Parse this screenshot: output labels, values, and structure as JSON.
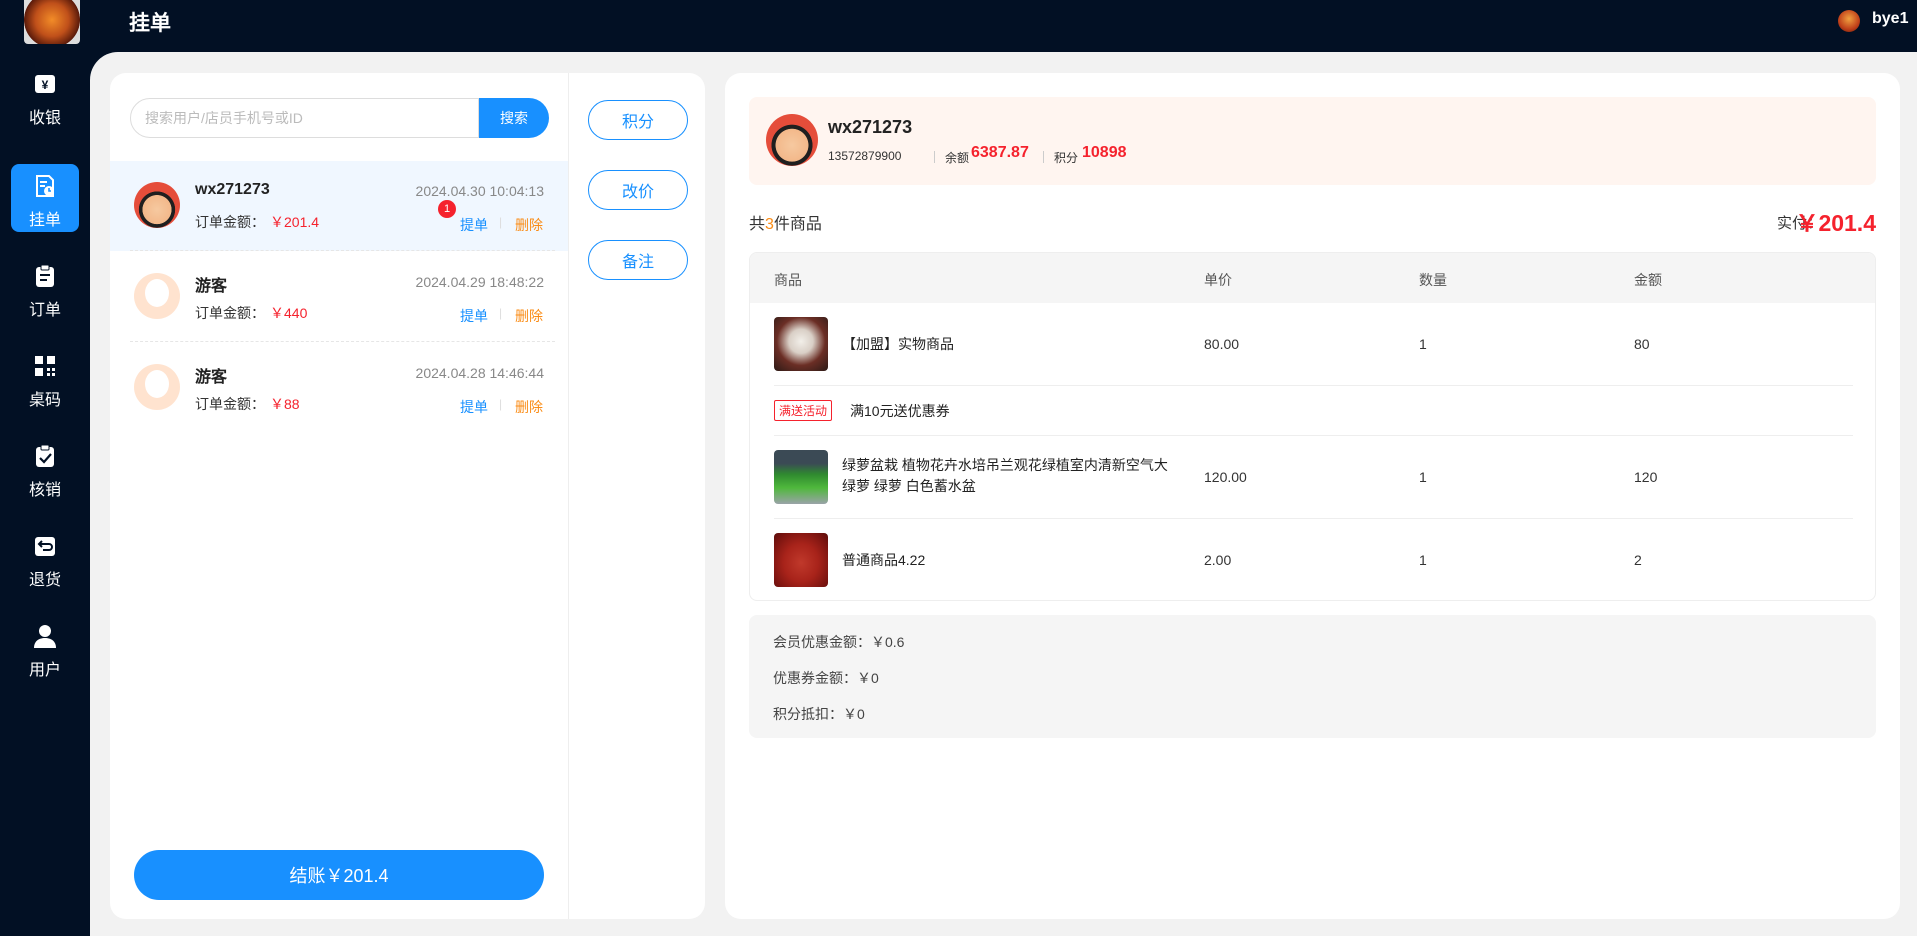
{
  "header": {
    "title": "挂单",
    "user_name": "bye1"
  },
  "sidebar": {
    "items": [
      {
        "label": "收银",
        "icon": "cash-register-icon",
        "active": false
      },
      {
        "label": "挂单",
        "icon": "hold-order-icon",
        "active": true
      },
      {
        "label": "订单",
        "icon": "clipboard-icon",
        "active": false
      },
      {
        "label": "桌码",
        "icon": "qr-code-icon",
        "active": false
      },
      {
        "label": "核销",
        "icon": "verify-icon",
        "active": false
      },
      {
        "label": "退货",
        "icon": "return-icon",
        "active": false
      },
      {
        "label": "用户",
        "icon": "user-icon",
        "active": false
      }
    ]
  },
  "search": {
    "placeholder": "搜索用户/店员手机号或ID",
    "button": "搜索"
  },
  "orders": [
    {
      "name": "wx271273",
      "time": "2024.04.30 10:04:13",
      "amount_label": "订单金额：",
      "amount": "￥201.4",
      "badge": "1",
      "pick": "提单",
      "delete": "删除"
    },
    {
      "name": "游客",
      "time": "2024.04.29 18:48:22",
      "amount_label": "订单金额：",
      "amount": "￥440",
      "pick": "提单",
      "delete": "删除"
    },
    {
      "name": "游客",
      "time": "2024.04.28 14:46:44",
      "amount_label": "订单金额：",
      "amount": "￥88",
      "pick": "提单",
      "delete": "删除"
    }
  ],
  "checkout": {
    "label": "结账￥201.4"
  },
  "actions": {
    "points": "积分",
    "change_price": "改价",
    "remark": "备注"
  },
  "member": {
    "name": "wx271273",
    "phone": "13572879900",
    "balance_label": "余额",
    "balance": "6387.87",
    "points_label": "积分",
    "points": "10898"
  },
  "cart": {
    "count_prefix": "共",
    "count": "3",
    "count_suffix": "件商品",
    "pay_label": "实付：",
    "pay_amount": "￥201.4"
  },
  "table": {
    "headers": {
      "goods": "商品",
      "price": "单价",
      "qty": "数量",
      "amount": "金额"
    },
    "rows": [
      {
        "name": "【加盟】实物商品",
        "price": "80.00",
        "qty": "1",
        "amount": "80"
      },
      {
        "name": "绿萝盆栽 植物花卉水培吊兰观花绿植室内清新空气大绿萝 绿萝 白色蓄水盆",
        "price": "120.00",
        "qty": "1",
        "amount": "120"
      },
      {
        "name": "普通商品4.22",
        "price": "2.00",
        "qty": "1",
        "amount": "2"
      }
    ],
    "promo": {
      "tag": "满送活动",
      "text": "满10元送优惠券"
    }
  },
  "summary": {
    "member_discount": "会员优惠金额：￥0.6",
    "coupon": "优惠券金额：￥0",
    "points_deduct": "积分抵扣：￥0"
  },
  "colors": {
    "accent": "#1890ff",
    "price": "#f5222d",
    "nav_bg": "#021024"
  }
}
